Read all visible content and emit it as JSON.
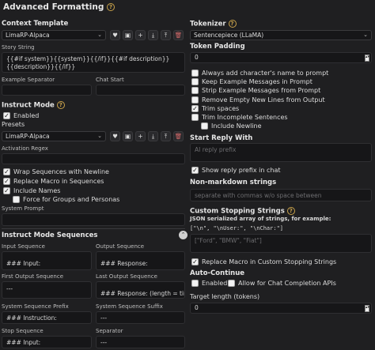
{
  "header": {
    "title": "Advanced Formatting"
  },
  "context": {
    "heading": "Context Template",
    "template_value": "LimaRP-Alpaca",
    "story_label": "Story String",
    "story_value": "{{#if system}}{{system}}{{/if}}{{#if description}}{{description}}{{/if}}",
    "example_sep_label": "Example Separator",
    "chat_start_label": "Chat Start"
  },
  "instruct": {
    "heading": "Instruct Mode",
    "enabled_label": "Enabled",
    "presets_label": "Presets",
    "preset_value": "LimaRP-Alpaca",
    "activation_regex_label": "Activation Regex",
    "wrap_label": "Wrap Sequences with Newline",
    "replace_macro_label": "Replace Macro in Sequences",
    "include_names_label": "Include Names",
    "force_groups_label": "Force for Groups and Personas",
    "system_prompt_label": "System Prompt"
  },
  "sequences": {
    "heading": "Instruct Mode Sequences",
    "input_label": "Input Sequence",
    "input_value": "### Input:",
    "output_label": "Output Sequence",
    "output_value": "### Response:",
    "first_output_label": "First Output Sequence",
    "first_output_value": "---",
    "last_output_label": "Last Output Sequence",
    "last_output_value": "### Response: (length = tiny)",
    "sys_prefix_label": "System Sequence Prefix",
    "sys_prefix_value": "### Instruction:",
    "sys_suffix_label": "System Sequence Suffix",
    "sys_suffix_value": "---",
    "stop_label": "Stop Sequence",
    "stop_value": "### Input:",
    "separator_label": "Separator",
    "separator_value": "---"
  },
  "tokenizer": {
    "heading": "Tokenizer",
    "value": "Sentencepiece (LLaMA)",
    "padding_label": "Token Padding",
    "padding_value": "0",
    "options": [
      {
        "label": "Always add character's name to prompt",
        "checked": false
      },
      {
        "label": "Keep Example Messages in Prompt",
        "checked": false
      },
      {
        "label": "Strip Example Messages from Prompt",
        "checked": false
      },
      {
        "label": "Remove Empty New Lines from Output",
        "checked": false
      },
      {
        "label": "Trim spaces",
        "checked": true
      },
      {
        "label": "Trim Incomplete Sentences",
        "checked": false
      }
    ],
    "include_newline_label": "Include Newline"
  },
  "reply": {
    "heading": "Start Reply With",
    "placeholder": "AI reply prefix",
    "show_prefix_label": "Show reply prefix in chat",
    "nonmarkdown_heading": "Non-markdown strings",
    "nonmarkdown_placeholder": "separate with commas w/o space between"
  },
  "stopping": {
    "heading": "Custom Stopping Strings",
    "desc": "JSON serialized array of strings, for example:",
    "example": "[\"\\n\", \"\\nUser:\", \"\\nChar:\"]",
    "placeholder": "[\"Ford\", \"BMW\", \"Fiat\"]",
    "replace_macro_label": "Replace Macro in Custom Stopping Strings"
  },
  "autocontinue": {
    "heading": "Auto-Continue",
    "enabled_label": "Enabled",
    "allow_label": "Allow for Chat Completion APIs",
    "target_label": "Target length (tokens)",
    "target_value": "0"
  },
  "colors": {
    "background": "#1f1f21",
    "field": "#161618",
    "accent": "#c9a24a"
  }
}
